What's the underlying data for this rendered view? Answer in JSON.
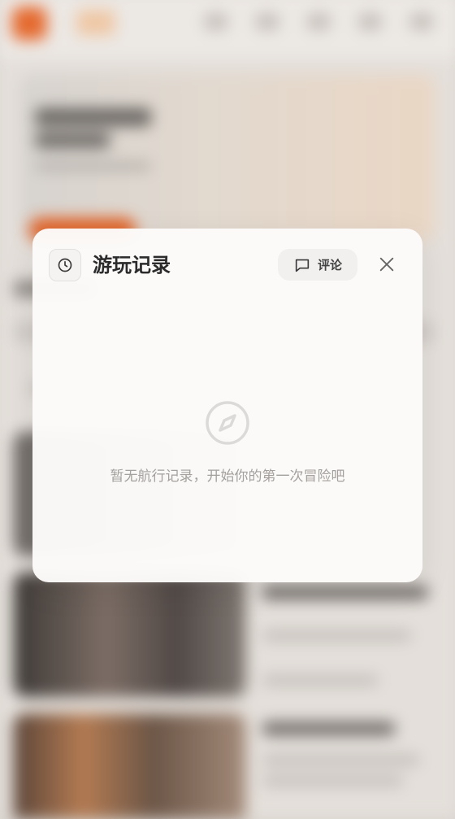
{
  "modal": {
    "title": "游玩记录",
    "comment_label": "评论",
    "empty_message": "暂无航行记录，开始你的第一次冒险吧",
    "icons": {
      "header": "history-clock-icon",
      "comment": "comment-icon",
      "close": "close-icon",
      "empty": "compass-icon"
    }
  },
  "colors": {
    "accent": "#e1652a",
    "modal_bg": "#fcfbfa",
    "title_text": "#2b2b2b",
    "muted_text": "#a3a09d"
  }
}
